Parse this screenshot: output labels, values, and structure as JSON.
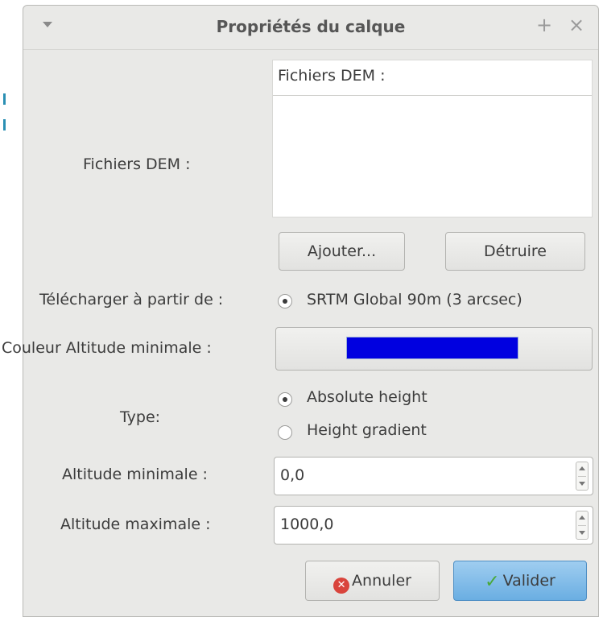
{
  "window": {
    "title": "Propriétés du calque",
    "plus_icon_glyph": "+",
    "close_icon_glyph": "×"
  },
  "dem": {
    "label": "Fichiers DEM :",
    "list_header": "Fichiers DEM :",
    "add_button": "Ajouter...",
    "remove_button": "Détruire"
  },
  "download": {
    "label": "Télécharger à partir de :",
    "option": "SRTM Global 90m (3 arcsec)",
    "selected": true
  },
  "color": {
    "label": "Couleur Altitude minimale :",
    "swatch_color": "#0000e0"
  },
  "type": {
    "label": "Type:",
    "options": [
      {
        "label": "Absolute height",
        "selected": true
      },
      {
        "label": "Height gradient",
        "selected": false
      }
    ]
  },
  "altitude": {
    "min_label": "Altitude minimale :",
    "min_value": "0,0",
    "max_label": "Altitude maximale :",
    "max_value": "1000,0"
  },
  "actions": {
    "cancel": "Annuler",
    "ok": "Valider",
    "ok_color": "#6aaee2",
    "cancel_icon": "cancel-icon",
    "ok_icon": "check-icon"
  }
}
